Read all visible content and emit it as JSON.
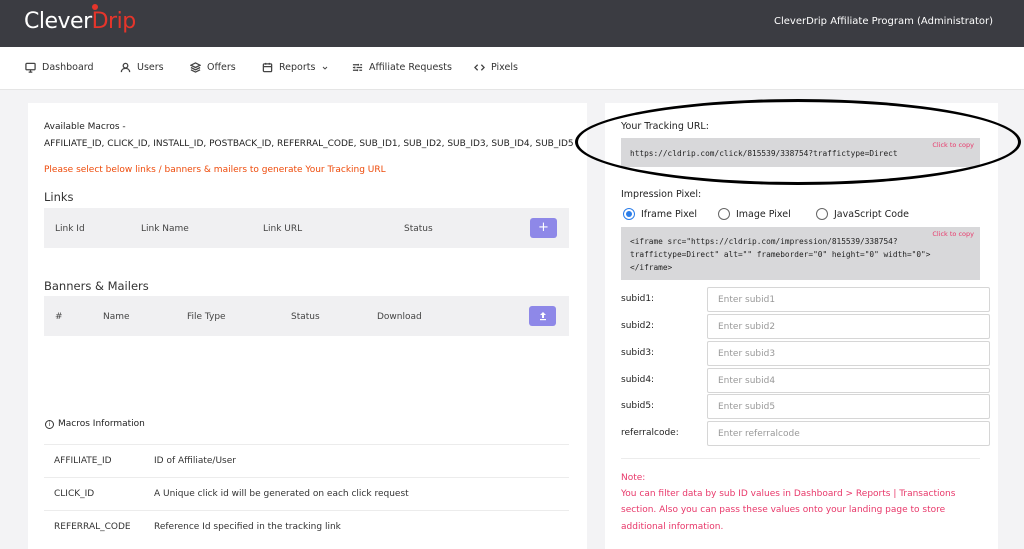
{
  "header": {
    "logo_part1": "Clever",
    "logo_part2": "Drip",
    "title": "CleverDrip Affiliate Program (Administrator)"
  },
  "nav": {
    "items": [
      {
        "label": "Dashboard",
        "icon": "monitor-icon"
      },
      {
        "label": "Users",
        "icon": "user-icon"
      },
      {
        "label": "Offers",
        "icon": "layers-icon"
      },
      {
        "label": "Reports",
        "icon": "calendar-icon"
      },
      {
        "label": "Affiliate Requests",
        "icon": "sliders-icon"
      },
      {
        "label": "Pixels",
        "icon": "code-icon"
      }
    ]
  },
  "left": {
    "macros_label": "Available Macros -",
    "macros_list": "AFFILIATE_ID, CLICK_ID, INSTALL_ID, POSTBACK_ID, REFERRAL_CODE, SUB_ID1, SUB_ID2, SUB_ID3, SUB_ID4, SUB_ID5",
    "select_message": "Please select below links / banners & mailers to generate Your Tracking URL",
    "links_title": "Links",
    "links_columns": [
      "Link Id",
      "Link Name",
      "Link URL",
      "Status"
    ],
    "add_symbol": "+",
    "banners_title": "Banners & Mailers",
    "banners_columns": [
      "#",
      "Name",
      "File Type",
      "Status",
      "Download"
    ],
    "info_icon": "i",
    "macros_info_title": "Macros Information",
    "macros_info": [
      {
        "key": "AFFILIATE_ID",
        "value": "ID of Affiliate/User"
      },
      {
        "key": "CLICK_ID",
        "value": "A Unique click id will be generated on each click request"
      },
      {
        "key": "REFERRAL_CODE",
        "value": "Reference Id specified in the tracking link"
      }
    ]
  },
  "right": {
    "tracking_label": "Your Tracking URL:",
    "tracking_url": "https://cldrip.com/click/815539/338754?traffictype=Direct",
    "click_to_copy": "Click to copy",
    "impression_label": "Impression Pixel:",
    "pixel_options": [
      "Iframe Pixel",
      "Image Pixel",
      "JavaScript Code"
    ],
    "pixel_selected": "Iframe Pixel",
    "iframe_line1": "<iframe src=\"https://cldrip.com/impression/815539/338754?",
    "iframe_line2": "traffictype=Direct\" alt=\"\" frameborder=\"0\" height=\"0\" width=\"0\">",
    "iframe_line3": "</iframe>",
    "subids": [
      {
        "label": "subid1:",
        "placeholder": "Enter subid1"
      },
      {
        "label": "subid2:",
        "placeholder": "Enter subid2"
      },
      {
        "label": "subid3:",
        "placeholder": "Enter subid3"
      },
      {
        "label": "subid4:",
        "placeholder": "Enter subid4"
      },
      {
        "label": "subid5:",
        "placeholder": "Enter subid5"
      },
      {
        "label": "referralcode:",
        "placeholder": "Enter referralcode"
      }
    ],
    "note_title": "Note:",
    "note_line1": "You can filter data by sub ID values in Dashboard > Reports | Transactions",
    "note_line2": "section. Also you can pass these values onto your landing page to store",
    "note_line3": "additional information."
  },
  "colors": {
    "topbar": "#3b3c42",
    "accent_purple": "#8e88e8",
    "orange_text": "#ee4b0b",
    "pink_text": "#e8386a",
    "radio_blue": "#2b7de9"
  }
}
